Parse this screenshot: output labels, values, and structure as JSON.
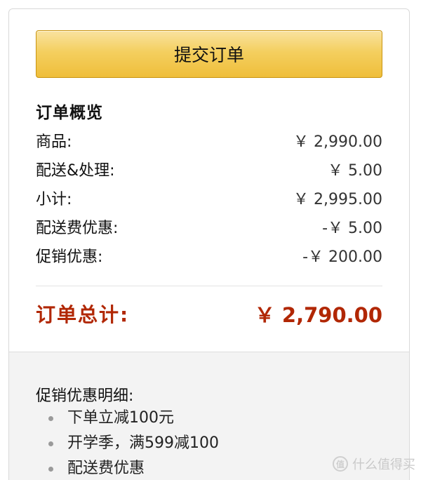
{
  "submit_button": {
    "label": "提交订单"
  },
  "summary": {
    "title": "订单概览",
    "rows": [
      {
        "label": "商品:",
        "value": "￥ 2,990.00"
      },
      {
        "label": "配送&处理:",
        "value": "￥ 5.00"
      },
      {
        "label": "小计:",
        "value": "￥ 2,995.00"
      },
      {
        "label": "配送费优惠:",
        "value": "-￥ 5.00"
      },
      {
        "label": "促销优惠:",
        "value": "-￥ 200.00"
      }
    ]
  },
  "total": {
    "label": "订单总计:",
    "value": "￥ 2,790.00",
    "color": "#b12704"
  },
  "promo": {
    "title": "促销优惠明细:",
    "items": [
      "下单立减100元",
      "开学季，满599减100",
      "配送费优惠"
    ]
  },
  "watermark": {
    "text": "什么值得买",
    "logo": "值"
  }
}
